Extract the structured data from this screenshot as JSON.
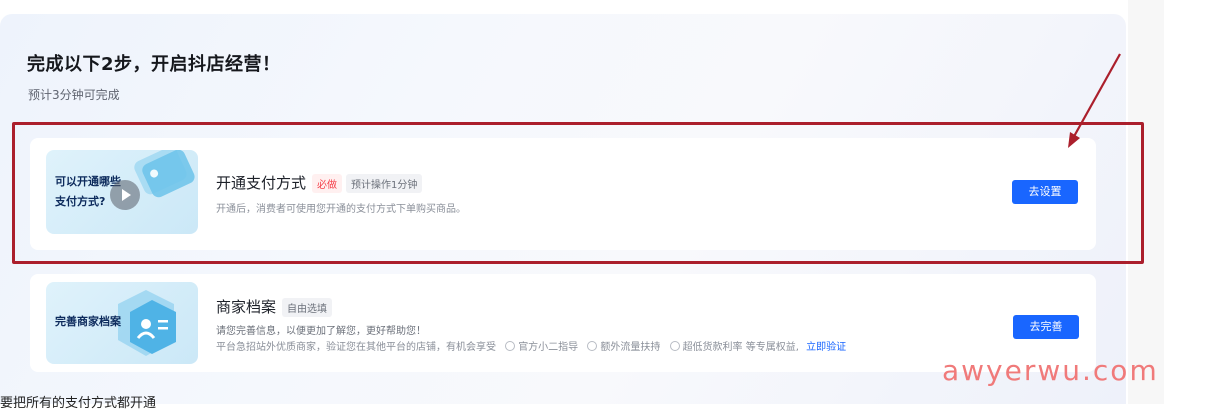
{
  "header": {
    "title": "完成以下2步，开启抖店经营！",
    "subtitle": "预计3分钟可完成"
  },
  "steps": [
    {
      "thumb_text_line1": "可以开通哪些",
      "thumb_text_line2": "支付方式?",
      "title": "开通支付方式",
      "required_tag": "必做",
      "time_tag": "预计操作1分钟",
      "description": "开通后，消费者可使用您开通的支付方式下单购买商品。",
      "button_label": "去设置"
    },
    {
      "thumb_text": "完善商家档案",
      "title": "商家档案",
      "optional_tag": "自由选填",
      "description_1": "请您完善信息，以便更加了解您，更好帮助您！",
      "description_2": "平台急招站外优质商家，验证您在其他平台的店铺，有机会享受",
      "benefits": [
        "官方小二指导",
        "额外流量扶持",
        "超低货款利率 等专属权益,"
      ],
      "verify_link": "立即验证",
      "button_label": "去完善"
    }
  ],
  "annotation": {
    "highlight_color": "#ab1f2c"
  },
  "watermark": "awyerwu.com",
  "caption": "要把所有的支付方式都开通"
}
